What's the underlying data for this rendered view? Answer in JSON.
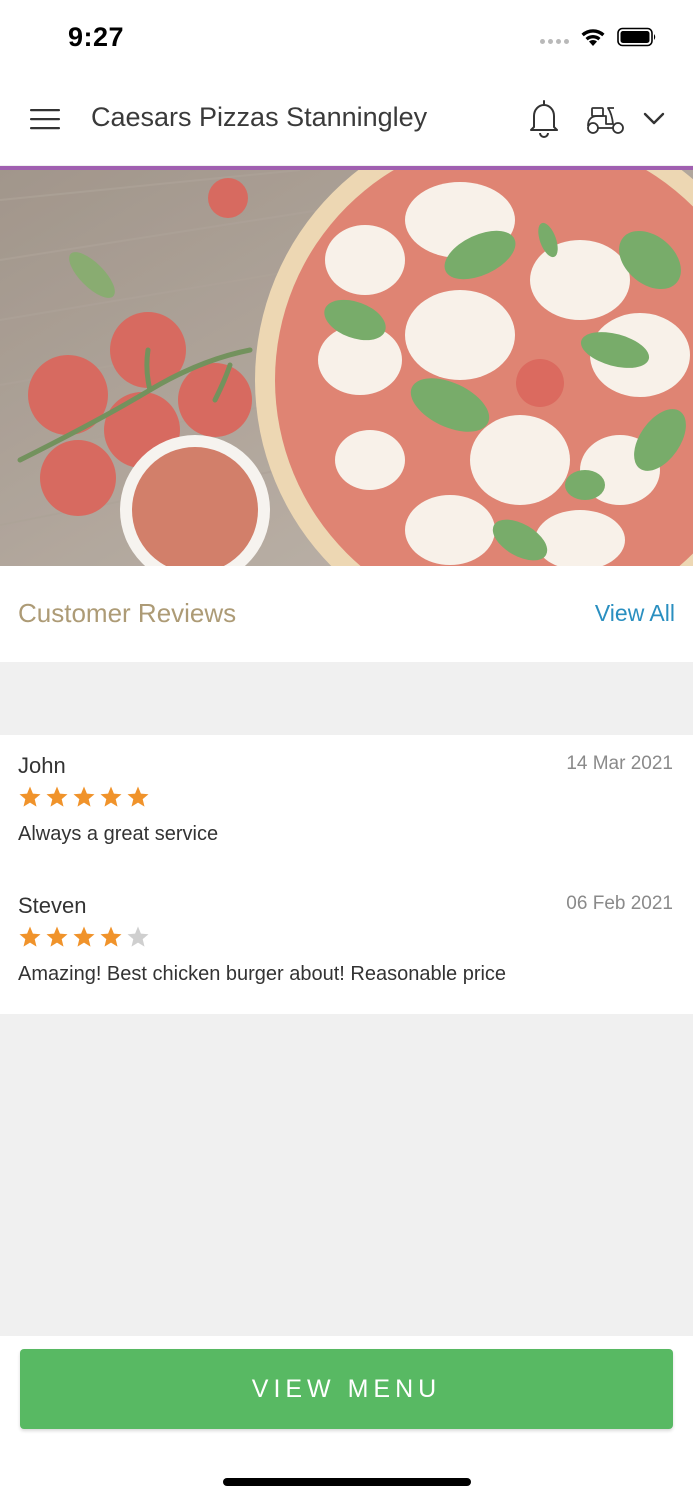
{
  "status_bar": {
    "time": "9:27",
    "icons": [
      "signal-dots-icon",
      "wifi-icon",
      "battery-icon"
    ]
  },
  "header": {
    "title": "Caesars Pizzas Stanningley",
    "icons": [
      "hamburger-menu-icon",
      "bell-icon",
      "scooter-icon",
      "chevron-down-icon"
    ],
    "accent_color": "#a05fb0"
  },
  "hero": {
    "image_description_icon": "pizza-hero-image"
  },
  "reviews": {
    "title": "Customer Reviews",
    "view_all_label": "View All",
    "title_color": "#ad9b76",
    "link_color": "#2a8fc0",
    "items": [
      {
        "name": "John",
        "date": "14 Mar 2021",
        "rating": 5,
        "max_rating": 5,
        "text": "Always a great service"
      },
      {
        "name": "Steven",
        "date": "06 Feb 2021",
        "rating": 4,
        "max_rating": 5,
        "text": "Amazing! Best chicken burger about! Reasonable price"
      }
    ],
    "star_color": "#f0932b",
    "empty_star_color": "#cfcfcf"
  },
  "footer": {
    "view_menu_label": "VIEW MENU",
    "button_color": "#58b963"
  }
}
